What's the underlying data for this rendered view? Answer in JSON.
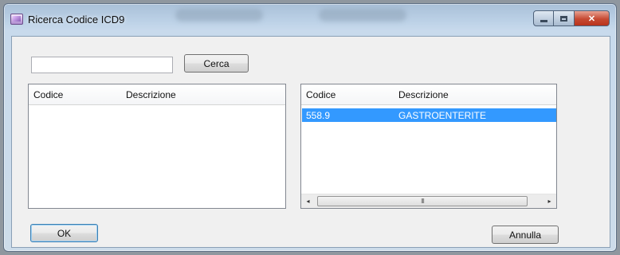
{
  "window": {
    "title": "Ricerca Codice ICD9"
  },
  "search": {
    "value": "",
    "placeholder": "",
    "button_label": "Cerca"
  },
  "left_list": {
    "columns": [
      "Codice",
      "Descrizione"
    ],
    "rows": []
  },
  "right_list": {
    "columns": [
      "Codice",
      "Descrizione"
    ],
    "rows": [
      {
        "codice": "558.9",
        "descrizione": "GASTROENTERITE",
        "selected": true
      }
    ],
    "scrollbar": {
      "left_arrow": "◂",
      "right_arrow": "▸",
      "thumb_grip": "III"
    }
  },
  "buttons": {
    "ok_label": "OK",
    "cancel_label": "Annulla"
  },
  "colors": {
    "selection": "#3399ff",
    "close_button": "#c64a32"
  }
}
